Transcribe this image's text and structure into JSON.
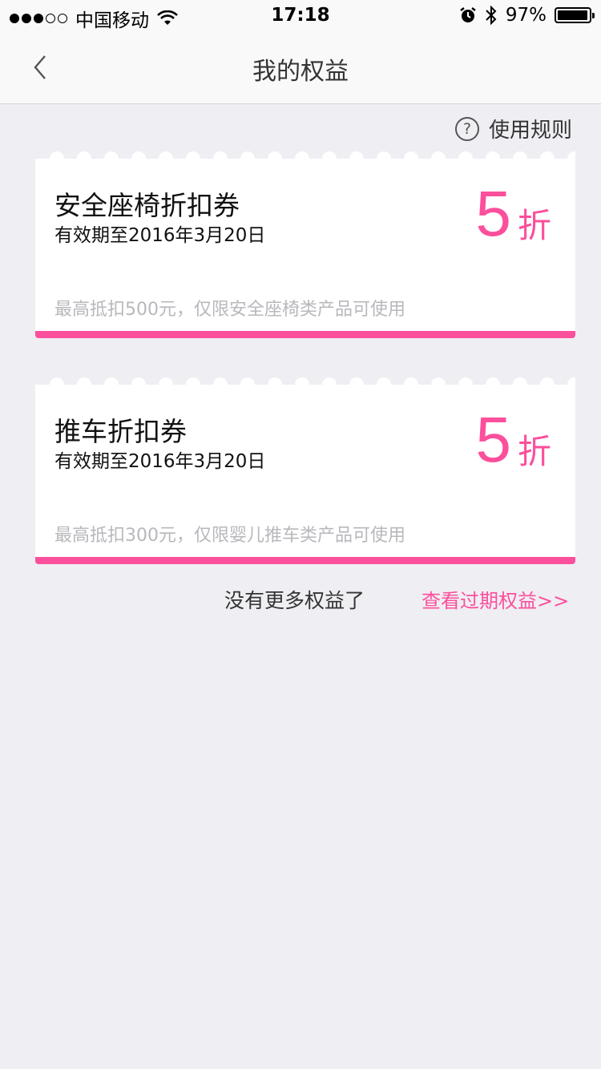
{
  "status_bar": {
    "carrier": "中国移动",
    "time": "17:18",
    "battery": "97%",
    "battery_level": 0.97
  },
  "nav": {
    "title": "我的权益"
  },
  "rules": {
    "label": "使用规则",
    "icon": "question-circle-icon"
  },
  "coupons": [
    {
      "title": "安全座椅折扣券",
      "valid": "有效期至2016年3月20日",
      "discount": "5",
      "unit": "折",
      "note": "最高抵扣500元，仅限安全座椅类产品可使用"
    },
    {
      "title": "推车折扣券",
      "valid": "有效期至2016年3月20日",
      "discount": "5",
      "unit": "折",
      "note": "最高抵扣300元，仅限婴儿推车类产品可使用"
    }
  ],
  "footer": {
    "no_more": "没有更多权益了",
    "expired_link": "查看过期权益>>"
  },
  "colors": {
    "accent": "#fc4f9c",
    "background": "#efeef3"
  }
}
